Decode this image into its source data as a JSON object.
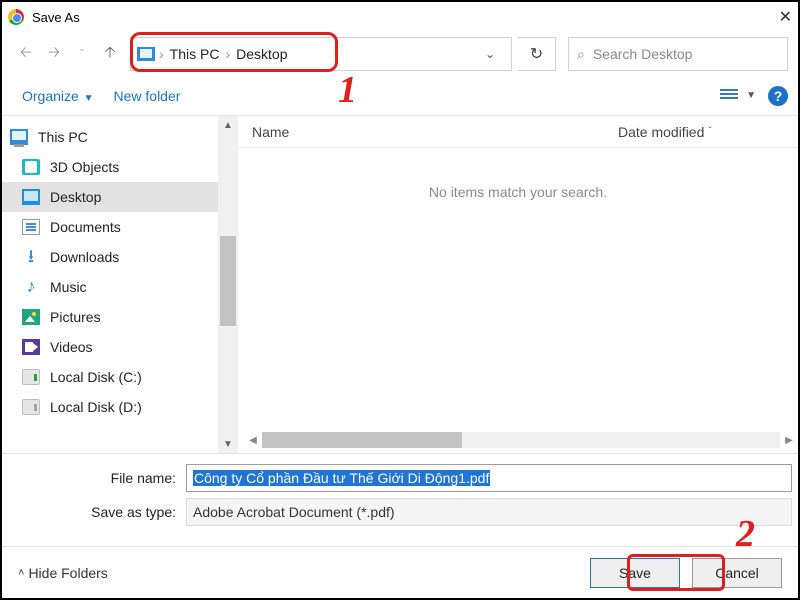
{
  "window": {
    "title": "Save As"
  },
  "nav": {
    "breadcrumb": [
      "This PC",
      "Desktop"
    ],
    "search_placeholder": "Search Desktop"
  },
  "toolbar": {
    "organize": "Organize",
    "new_folder": "New folder"
  },
  "sidebar": {
    "items": [
      {
        "label": "This PC",
        "icon": "pc",
        "root": true
      },
      {
        "label": "3D Objects",
        "icon": "3d"
      },
      {
        "label": "Desktop",
        "icon": "desk",
        "selected": true
      },
      {
        "label": "Documents",
        "icon": "doc"
      },
      {
        "label": "Downloads",
        "icon": "dl"
      },
      {
        "label": "Music",
        "icon": "music"
      },
      {
        "label": "Pictures",
        "icon": "pic"
      },
      {
        "label": "Videos",
        "icon": "vid"
      },
      {
        "label": "Local Disk (C:)",
        "icon": "drive-c"
      },
      {
        "label": "Local Disk (D:)",
        "icon": "drive-d"
      }
    ]
  },
  "list": {
    "columns": {
      "name": "Name",
      "date_modified": "Date modified"
    },
    "empty_text": "No items match your search."
  },
  "form": {
    "file_name_label": "File name:",
    "file_name_value": "Công ty Cổ phần Đầu tư Thế Giới Di Động1.pdf",
    "save_type_label": "Save as type:",
    "save_type_value": "Adobe Acrobat Document (*.pdf)"
  },
  "footer": {
    "hide_folders": "Hide Folders",
    "save": "Save",
    "cancel": "Cancel"
  },
  "annotations": {
    "one": "1",
    "two": "2"
  }
}
